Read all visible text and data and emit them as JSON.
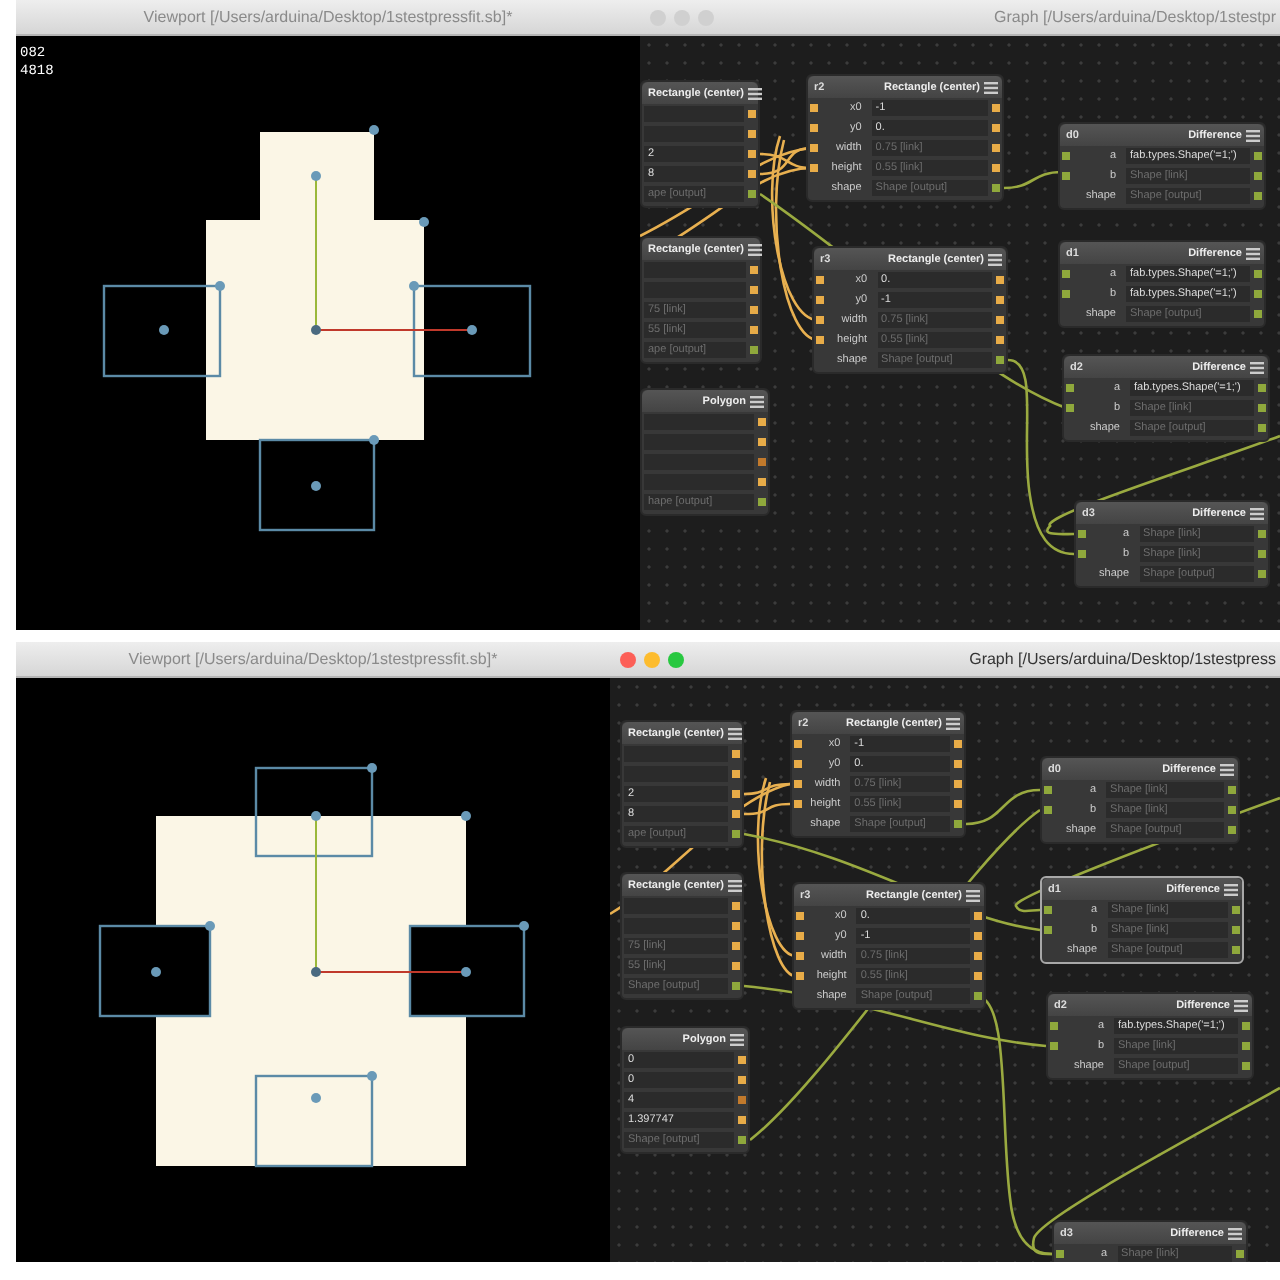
{
  "panels": [
    {
      "viewport": {
        "title": "Viewport [/Users/arduina/Desktop/1stestpressfit.sb]*",
        "readouts": [
          "082",
          "4818"
        ]
      },
      "graph": {
        "title": "Graph [/Users/arduina/Desktop/1stestpr",
        "active": false,
        "nodes": [
          {
            "type": "Rectangle (center)",
            "selected": false,
            "rows": [
              {
                "kind": "number"
              },
              {
                "kind": "number"
              },
              {
                "value": "2",
                "kind": "number",
                "linked": false
              },
              {
                "value": "8",
                "kind": "number",
                "linked": false
              },
              {
                "value": "ape [output]",
                "kind": "output",
                "linked": true
              }
            ]
          },
          {
            "name": "r2",
            "type": "Rectangle (center)",
            "selected": false,
            "rows": [
              {
                "label": "x0",
                "value": "-1",
                "kind": "number",
                "linked": false
              },
              {
                "label": "y0",
                "value": "0.",
                "kind": "number",
                "linked": false
              },
              {
                "label": "width",
                "value": "0.75 [link]",
                "kind": "number",
                "linked": true
              },
              {
                "label": "height",
                "value": "0.55 [link]",
                "kind": "number",
                "linked": true
              },
              {
                "label": "shape",
                "value": "Shape [output]",
                "kind": "output",
                "linked": true
              }
            ]
          },
          {
            "name": "d0",
            "type": "Difference",
            "selected": false,
            "rows": [
              {
                "label": "a",
                "value": "fab.types.Shape('=1;')",
                "kind": "shape",
                "linked": false
              },
              {
                "label": "b",
                "value": "Shape [link]",
                "kind": "shape",
                "linked": true
              },
              {
                "label": "shape",
                "value": "Shape [output]",
                "kind": "output",
                "linked": true
              }
            ]
          },
          {
            "type": "Rectangle (center)",
            "selected": false,
            "rows": [
              {
                "kind": "number"
              },
              {
                "kind": "number"
              },
              {
                "value": "75 [link]",
                "kind": "number",
                "linked": true
              },
              {
                "value": "55 [link]",
                "kind": "number",
                "linked": true
              },
              {
                "value": "ape [output]",
                "kind": "output",
                "linked": true
              }
            ]
          },
          {
            "name": "r3",
            "type": "Rectangle (center)",
            "selected": false,
            "rows": [
              {
                "label": "x0",
                "value": "0.",
                "kind": "number",
                "linked": false
              },
              {
                "label": "y0",
                "value": "-1",
                "kind": "number",
                "linked": false
              },
              {
                "label": "width",
                "value": "0.75 [link]",
                "kind": "number",
                "linked": true
              },
              {
                "label": "height",
                "value": "0.55 [link]",
                "kind": "number",
                "linked": true
              },
              {
                "label": "shape",
                "value": "Shape [output]",
                "kind": "output",
                "linked": true
              }
            ]
          },
          {
            "name": "d1",
            "type": "Difference",
            "selected": false,
            "rows": [
              {
                "label": "a",
                "value": "fab.types.Shape('=1;')",
                "kind": "shape",
                "linked": false
              },
              {
                "label": "b",
                "value": "fab.types.Shape('=1;')",
                "kind": "shape",
                "linked": false
              },
              {
                "label": "shape",
                "value": "Shape [output]",
                "kind": "output",
                "linked": true
              }
            ]
          },
          {
            "type": "Polygon",
            "selected": false,
            "rows": [
              {
                "kind": "number"
              },
              {
                "kind": "number"
              },
              {
                "kind": "int"
              },
              {
                "kind": "number"
              },
              {
                "value": "hape [output]",
                "kind": "output",
                "linked": true
              }
            ]
          },
          {
            "name": "d2",
            "type": "Difference",
            "selected": false,
            "rows": [
              {
                "label": "a",
                "value": "fab.types.Shape('=1;')",
                "kind": "shape",
                "linked": false
              },
              {
                "label": "b",
                "value": "Shape [link]",
                "kind": "shape",
                "linked": true
              },
              {
                "label": "shape",
                "value": "Shape [output]",
                "kind": "output",
                "linked": true
              }
            ]
          },
          {
            "name": "d3",
            "type": "Difference",
            "selected": false,
            "rows": [
              {
                "label": "a",
                "value": "Shape [link]",
                "kind": "shape",
                "linked": true
              },
              {
                "label": "b",
                "value": "Shape [link]",
                "kind": "shape",
                "linked": true
              },
              {
                "label": "shape",
                "value": "Shape [output]",
                "kind": "output",
                "linked": true
              }
            ]
          }
        ]
      }
    },
    {
      "viewport": {
        "title": "Viewport [/Users/arduina/Desktop/1stestpressfit.sb]*"
      },
      "graph": {
        "title": "Graph [/Users/arduina/Desktop/1stestpress",
        "active": true,
        "nodes": [
          {
            "type": "Rectangle (center)",
            "selected": false,
            "rows": [
              {
                "kind": "number"
              },
              {
                "kind": "number"
              },
              {
                "value": "2",
                "kind": "number",
                "linked": false
              },
              {
                "value": "8",
                "kind": "number",
                "linked": false
              },
              {
                "value": "ape [output]",
                "kind": "output",
                "linked": true
              }
            ]
          },
          {
            "name": "r2",
            "type": "Rectangle (center)",
            "selected": false,
            "rows": [
              {
                "label": "x0",
                "value": "-1",
                "kind": "number",
                "linked": false
              },
              {
                "label": "y0",
                "value": "0.",
                "kind": "number",
                "linked": false
              },
              {
                "label": "width",
                "value": "0.75 [link]",
                "kind": "number",
                "linked": true
              },
              {
                "label": "height",
                "value": "0.55 [link]",
                "kind": "number",
                "linked": true
              },
              {
                "label": "shape",
                "value": "Shape [output]",
                "kind": "output",
                "linked": true
              }
            ]
          },
          {
            "name": "d0",
            "type": "Difference",
            "selected": false,
            "rows": [
              {
                "label": "a",
                "value": "Shape [link]",
                "kind": "shape",
                "linked": true
              },
              {
                "label": "b",
                "value": "Shape [link]",
                "kind": "shape",
                "linked": true
              },
              {
                "label": "shape",
                "value": "Shape [output]",
                "kind": "output",
                "linked": true
              }
            ]
          },
          {
            "type": "Rectangle (center)",
            "selected": false,
            "rows": [
              {
                "kind": "number"
              },
              {
                "kind": "number"
              },
              {
                "value": "75 [link]",
                "kind": "number",
                "linked": true
              },
              {
                "value": "55 [link]",
                "kind": "number",
                "linked": true
              },
              {
                "value": "Shape [output]",
                "kind": "output",
                "linked": true
              }
            ]
          },
          {
            "name": "r3",
            "type": "Rectangle (center)",
            "selected": false,
            "rows": [
              {
                "label": "x0",
                "value": "0.",
                "kind": "number",
                "linked": false
              },
              {
                "label": "y0",
                "value": "-1",
                "kind": "number",
                "linked": false
              },
              {
                "label": "width",
                "value": "0.75 [link]",
                "kind": "number",
                "linked": true
              },
              {
                "label": "height",
                "value": "0.55 [link]",
                "kind": "number",
                "linked": true
              },
              {
                "label": "shape",
                "value": "Shape [output]",
                "kind": "output",
                "linked": true
              }
            ]
          },
          {
            "name": "d1",
            "type": "Difference",
            "selected": true,
            "rows": [
              {
                "label": "a",
                "value": "Shape [link]",
                "kind": "shape",
                "linked": true
              },
              {
                "label": "b",
                "value": "Shape [link]",
                "kind": "shape",
                "linked": true
              },
              {
                "label": "shape",
                "value": "Shape [output]",
                "kind": "output",
                "linked": true
              }
            ]
          },
          {
            "type": "Polygon",
            "selected": false,
            "rows": [
              {
                "value": "0",
                "kind": "number",
                "linked": false
              },
              {
                "value": "0",
                "kind": "number",
                "linked": false
              },
              {
                "value": "4",
                "kind": "int",
                "linked": false
              },
              {
                "value": "1.397747",
                "kind": "number",
                "linked": false
              },
              {
                "value": "Shape [output]",
                "kind": "output",
                "linked": true
              }
            ]
          },
          {
            "name": "d2",
            "type": "Difference",
            "selected": false,
            "rows": [
              {
                "label": "a",
                "value": "fab.types.Shape('=1;')",
                "kind": "shape",
                "linked": false
              },
              {
                "label": "b",
                "value": "Shape [link]",
                "kind": "shape",
                "linked": true
              },
              {
                "label": "shape",
                "value": "Shape [output]",
                "kind": "output",
                "linked": true
              }
            ]
          },
          {
            "name": "d3",
            "type": "Difference",
            "selected": false,
            "rows": [
              {
                "label": "a",
                "value": "Shape [link]",
                "kind": "shape",
                "linked": true
              }
            ]
          }
        ]
      }
    }
  ]
}
